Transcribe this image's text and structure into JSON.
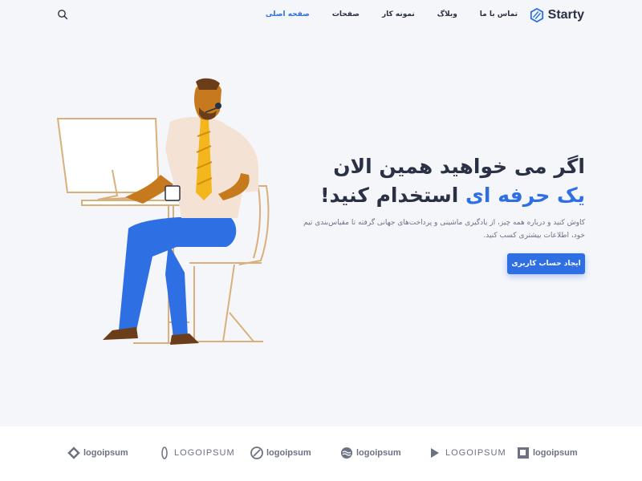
{
  "header": {
    "brand": "Starty",
    "nav": [
      "صفحه اصلی",
      "صفحات",
      "نمونه کار",
      "وبلاگ",
      "تماس با ما"
    ],
    "active_index": 0
  },
  "hero": {
    "title_line1": "اگر می خواهید همین الان",
    "title_accent": "یک حرفه ای",
    "title_rest": "استخدام کنید!",
    "description": "کاوش کنید و درباره همه چیز، از یادگیری ماشینی و پرداخت‌های جهانی گرفته تا مقیاس‌بندی تیم خود، اطلاعات بیشتری کسب کنید.",
    "cta_label": "ایجاد حساب کاربری"
  },
  "logos": [
    "logoipsum",
    "LOGOIPSUM",
    "logoipsum",
    "logoipsum",
    "LOGOIPSUM",
    "logoipsum"
  ],
  "colors": {
    "accent": "#2f6fe4",
    "text": "#2b3145",
    "background": "#f5f6fa"
  }
}
